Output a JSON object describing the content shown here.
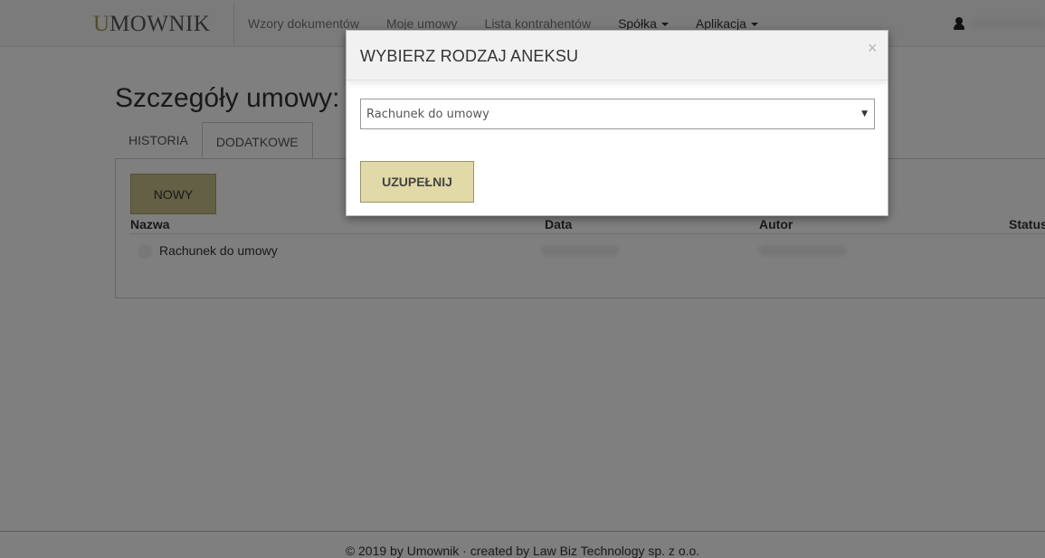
{
  "navbar": {
    "brand_mark": "U",
    "brand_text": "MOWNIK",
    "items": [
      {
        "label": "Wzory dokumentów"
      },
      {
        "label": "Moje umowy"
      },
      {
        "label": "Lista kontrahentów"
      },
      {
        "label": "Spółka"
      },
      {
        "label": "Aplikacja"
      }
    ],
    "user_icon": "user-icon"
  },
  "page": {
    "title": "Szczegóły umowy: V",
    "tabs": [
      {
        "label": "HISTORIA"
      },
      {
        "label": "DODATKOWE"
      }
    ],
    "new_button_label": "NOWY",
    "table": {
      "headers": [
        "Nazwa",
        "Data",
        "Autor",
        "Status"
      ],
      "rows": [
        {
          "name": "Rachunek do umowy"
        }
      ]
    }
  },
  "footer": {
    "text": "© 2019 by Umownik · created by Law Biz Technology sp. z o.o."
  },
  "modal": {
    "title": "WYBIERZ RODZAJ ANEKSU",
    "close_glyph": "×",
    "select_value": "Rachunek do umowy",
    "select_arrow": "▼",
    "submit_label": "UZUPEŁNIJ"
  }
}
